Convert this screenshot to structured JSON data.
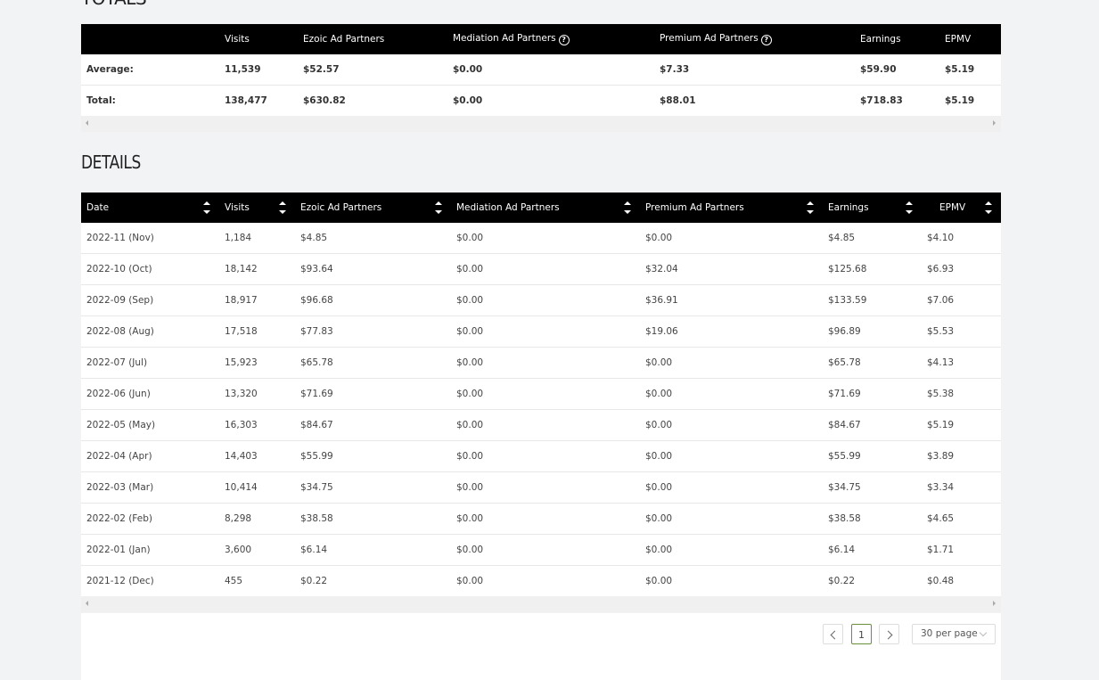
{
  "totals": {
    "heading": "TOTALS",
    "headers": [
      "",
      "Visits",
      "Ezoic Ad Partners",
      "Mediation Ad Partners",
      "Premium Ad Partners",
      "Earnings",
      "EPMV"
    ],
    "rows": [
      [
        "Average:",
        "11,539",
        "$52.57",
        "$0.00",
        "$7.33",
        "$59.90",
        "$5.19"
      ],
      [
        "Total:",
        "138,477",
        "$630.82",
        "$0.00",
        "$88.01",
        "$718.83",
        "$5.19"
      ]
    ]
  },
  "details": {
    "heading": "DETAILS",
    "headers": [
      "Date",
      "Visits",
      "Ezoic Ad Partners",
      "Mediation Ad Partners",
      "Premium Ad Partners",
      "Earnings",
      "EPMV"
    ],
    "rows": [
      [
        "2022-11 (Nov)",
        "1,184",
        "$4.85",
        "$0.00",
        "$0.00",
        "$4.85",
        "$4.10"
      ],
      [
        "2022-10 (Oct)",
        "18,142",
        "$93.64",
        "$0.00",
        "$32.04",
        "$125.68",
        "$6.93"
      ],
      [
        "2022-09 (Sep)",
        "18,917",
        "$96.68",
        "$0.00",
        "$36.91",
        "$133.59",
        "$7.06"
      ],
      [
        "2022-08 (Aug)",
        "17,518",
        "$77.83",
        "$0.00",
        "$19.06",
        "$96.89",
        "$5.53"
      ],
      [
        "2022-07 (Jul)",
        "15,923",
        "$65.78",
        "$0.00",
        "$0.00",
        "$65.78",
        "$4.13"
      ],
      [
        "2022-06 (Jun)",
        "13,320",
        "$71.69",
        "$0.00",
        "$0.00",
        "$71.69",
        "$5.38"
      ],
      [
        "2022-05 (May)",
        "16,303",
        "$84.67",
        "$0.00",
        "$0.00",
        "$84.67",
        "$5.19"
      ],
      [
        "2022-04 (Apr)",
        "14,403",
        "$55.99",
        "$0.00",
        "$0.00",
        "$55.99",
        "$3.89"
      ],
      [
        "2022-03 (Mar)",
        "10,414",
        "$34.75",
        "$0.00",
        "$0.00",
        "$34.75",
        "$3.34"
      ],
      [
        "2022-02 (Feb)",
        "8,298",
        "$38.58",
        "$0.00",
        "$0.00",
        "$38.58",
        "$4.65"
      ],
      [
        "2022-01 (Jan)",
        "3,600",
        "$6.14",
        "$0.00",
        "$0.00",
        "$6.14",
        "$1.71"
      ],
      [
        "2021-12 (Dec)",
        "455",
        "$0.22",
        "$0.00",
        "$0.00",
        "$0.22",
        "$0.48"
      ]
    ]
  },
  "pagination": {
    "current_page": "1",
    "per_page": "30 per page"
  },
  "colors": {
    "header_bg": "#000000",
    "active_page_border": "#6a8f3a",
    "page_bg": "#f2f3f5"
  }
}
